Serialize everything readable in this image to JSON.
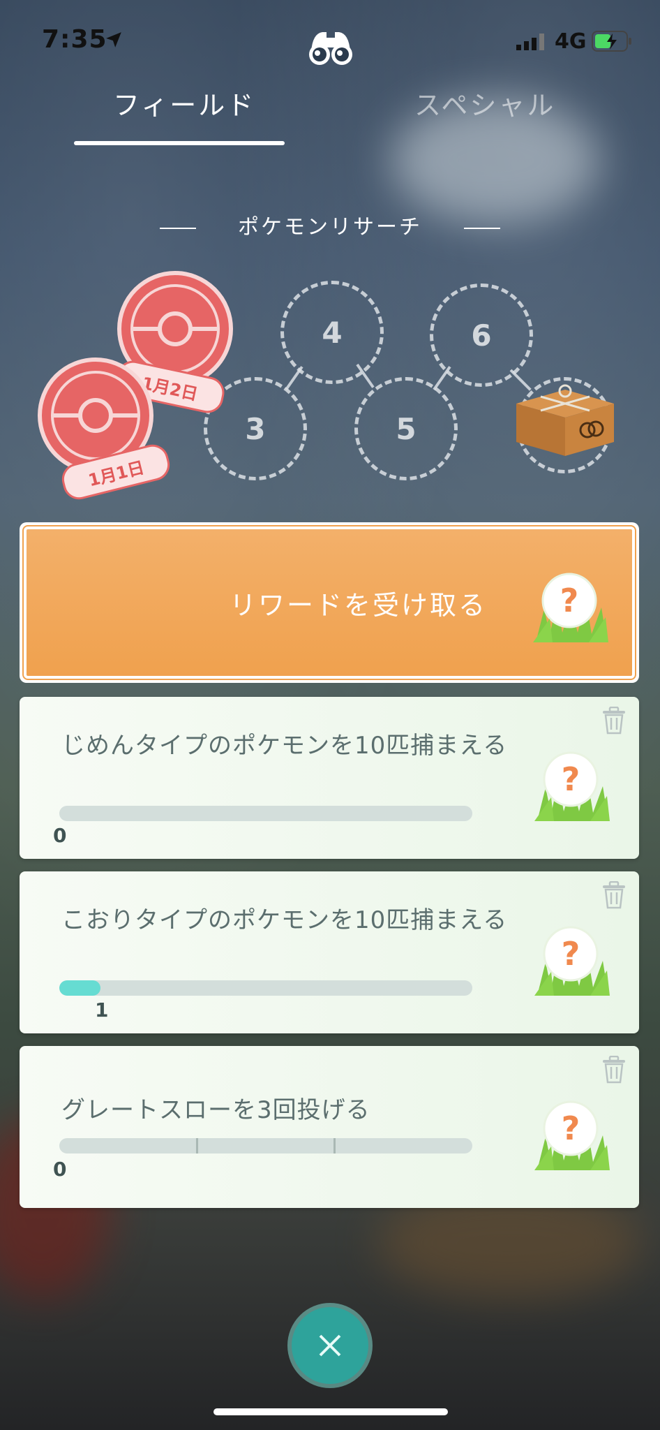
{
  "status_bar": {
    "time": "7:35",
    "network": "4G"
  },
  "tabs": {
    "field": "フィールド",
    "special": "スペシャル"
  },
  "section_title": "ポケモンリサーチ",
  "stamps": [
    {
      "label": "1月2日"
    },
    {
      "label": "1月1日"
    }
  ],
  "progress_circles": [
    "3",
    "4",
    "5",
    "6"
  ],
  "claim": {
    "label": "リワードを受け取る"
  },
  "tasks": [
    {
      "text": "じめんタイプのポケモンを10匹捕まえる",
      "progress": 0,
      "goal": 10,
      "count": "0"
    },
    {
      "text": "こおりタイプのポケモンを10匹捕まえる",
      "progress": 1,
      "goal": 10,
      "count": "1"
    },
    {
      "text": "グレートスローを3回投げる",
      "progress": 0,
      "goal": 3,
      "count": "0"
    }
  ],
  "reward_icon": {
    "symbol": "?"
  },
  "colors": {
    "claim": "#f0a14e",
    "bar_fill": "#66dcd2",
    "close_button": "#2ea39b"
  },
  "icons": [
    "location-arrow-icon",
    "binoculars-icon",
    "signal-icon",
    "battery-icon",
    "trash-icon",
    "mystery-reward-icon",
    "close-icon",
    "gift-box-icon",
    "pokestop-stamp-icon"
  ]
}
